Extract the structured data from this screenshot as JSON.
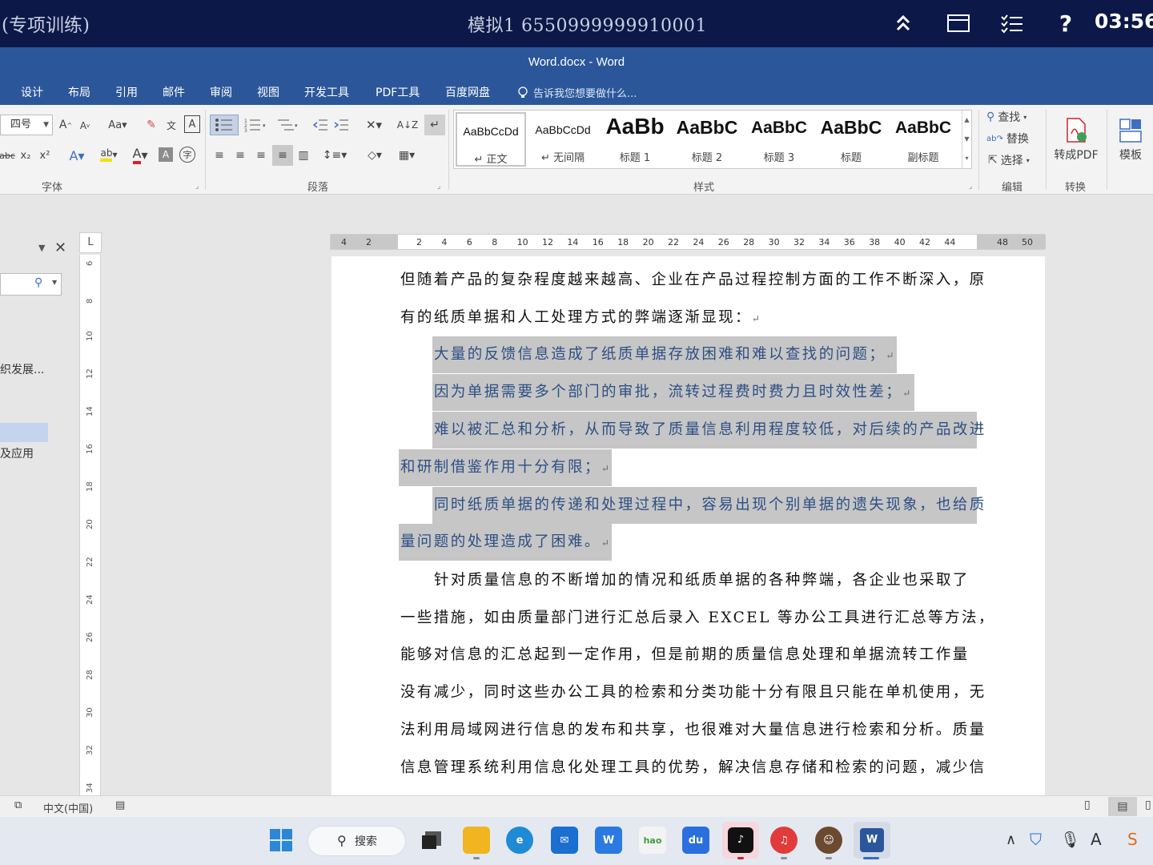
{
  "exam": {
    "left_title": "(专项训练)",
    "center_title": "模拟1   6550999999910001",
    "clock": "03:56"
  },
  "window": {
    "title": "Word.docx - Word"
  },
  "menu": {
    "tabs": [
      "设计",
      "布局",
      "引用",
      "邮件",
      "审阅",
      "视图",
      "开发工具",
      "PDF工具",
      "百度网盘"
    ],
    "tell_me": "告诉我您想要做什么..."
  },
  "ribbon": {
    "font_size": "四号",
    "group_font": "字体",
    "group_paragraph": "段落",
    "group_styles": "样式",
    "group_edit": "编辑",
    "group_convert": "转换",
    "find": "查找",
    "replace": "替换",
    "select": "选择",
    "to_pdf": "转成PDF",
    "template": "模板",
    "styles": [
      {
        "sample": "AaBbCcDd",
        "name": "↵ 正文"
      },
      {
        "sample": "AaBbCcDd",
        "name": "↵ 无间隔"
      },
      {
        "sample": "AaBb",
        "name": "标题 1"
      },
      {
        "sample": "AaBbC",
        "name": "标题 2"
      },
      {
        "sample": "AaBbC",
        "name": "标题 3"
      },
      {
        "sample": "AaBbC",
        "name": "标题"
      },
      {
        "sample": "AaBbC",
        "name": "副标题"
      }
    ]
  },
  "nav_pane": {
    "item1": "织发展...",
    "item2": "及应用"
  },
  "ruler": {
    "h_numbers": [
      "4",
      "2",
      "2",
      "4",
      "6",
      "8",
      "10",
      "12",
      "14",
      "16",
      "18",
      "20",
      "22",
      "24",
      "26",
      "28",
      "30",
      "32",
      "34",
      "36",
      "38",
      "40",
      "42",
      "44",
      "48",
      "50"
    ],
    "v_numbers": [
      "6",
      "8",
      "10",
      "12",
      "14",
      "16",
      "18",
      "20",
      "22",
      "24",
      "26",
      "28",
      "30",
      "32",
      "34"
    ]
  },
  "document": {
    "lines": [
      "但随着产品的复杂程度越来越高、企业在产品过程控制方面的工作不断深入，原",
      "有的纸质单据和人工处理方式的弊端逐渐显现：",
      "大量的反馈信息造成了纸质单据存放困难和难以查找的问题；",
      "因为单据需要多个部门的审批，流转过程费时费力且时效性差；",
      "难以被汇总和分析，从而导致了质量信息利用程度较低，对后续的产品改进",
      "和研制借鉴作用十分有限；",
      "同时纸质单据的传递和处理过程中，容易出现个别单据的遗失现象，也给质",
      "量问题的处理造成了困难。",
      "针对质量信息的不断增加的情况和纸质单据的各种弊端，各企业也采取了",
      "一些措施，如由质量部门进行汇总后录入 EXCEL 等办公工具进行汇总等方法，",
      "能够对信息的汇总起到一定作用，但是前期的质量信息处理和单据流转工作量",
      "没有减少，同时这些办公工具的检索和分类功能十分有限且只能在单机使用，无",
      "法利用局域网进行信息的发布和共享，也很难对大量信息进行检索和分析。质量",
      "信息管理系统利用信息化处理工具的优势，解决信息存储和检索的问题，减少信"
    ]
  },
  "status": {
    "language": "中文(中国)"
  },
  "taskbar": {
    "search": "搜索"
  }
}
